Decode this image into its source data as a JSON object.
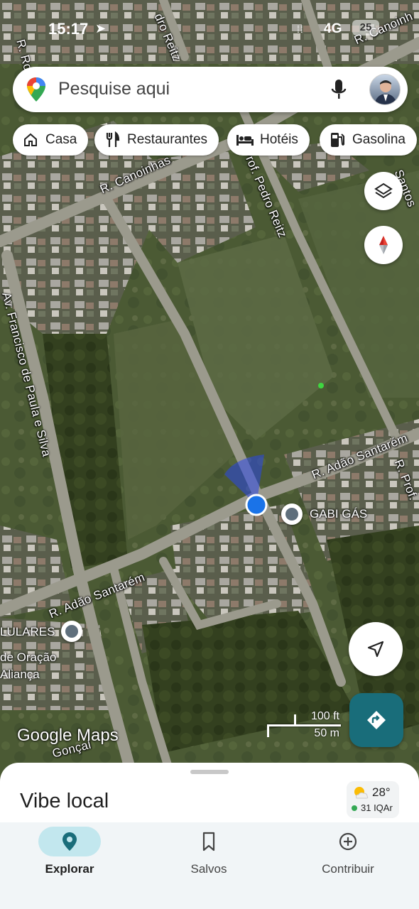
{
  "status_bar": {
    "time": "15:17",
    "network": "4G",
    "battery": "25"
  },
  "search": {
    "placeholder": "Pesquise aqui"
  },
  "chips": [
    {
      "label": "Casa",
      "icon": "home-icon"
    },
    {
      "label": "Restaurantes",
      "icon": "restaurant-icon"
    },
    {
      "label": "Hotéis",
      "icon": "hotel-icon"
    },
    {
      "label": "Gasolina",
      "icon": "gas-station-icon"
    }
  ],
  "map": {
    "road_labels": {
      "r_canoinhas_top": "R. Canoinh",
      "r_canoinhas_mid": "R. Canoinhas",
      "prof_pedro_reitz": "Prof. Pedro Reitz",
      "pedro_reitz_top": "dro Reitz",
      "r_ro": "R. Ro",
      "santos": "Santos",
      "av_francisco": "Av. Francisco de Paula e Silva",
      "r_adao_santarem_right": "R. Adão Santarém",
      "r_adao_santarem_left": "R. Adão Santarém",
      "r_prof": "R. Prof.",
      "goncalves": "Gonçal"
    },
    "pois": [
      {
        "label": "GABI GÁS"
      },
      {
        "label": "LULARES"
      }
    ],
    "other_labels": {
      "oracao_line1": "de Oração",
      "oracao_line2": "Aliança"
    },
    "scale": {
      "feet": "100 ft",
      "meters": "50 m"
    },
    "attribution": "Google Maps"
  },
  "sheet": {
    "title": "Vibe local",
    "weather": {
      "temperature": "28°",
      "air_quality": "31 IQAr"
    }
  },
  "nav": {
    "items": [
      {
        "label": "Explorar",
        "icon": "explore-pin-icon",
        "active": true
      },
      {
        "label": "Salvos",
        "icon": "bookmark-icon",
        "active": false
      },
      {
        "label": "Contribuir",
        "icon": "add-circle-icon",
        "active": false
      }
    ]
  },
  "colors": {
    "accent": "#196d7a",
    "active_pill": "#c2e7ee",
    "location_dot": "#1a73e8"
  }
}
